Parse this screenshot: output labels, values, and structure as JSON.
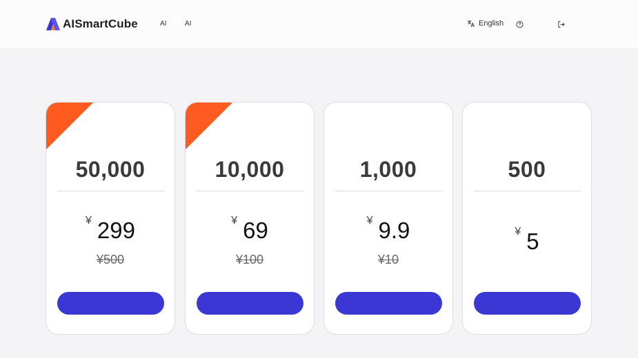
{
  "header": {
    "brand": "AISmartCube",
    "nav": [
      "AI",
      "AI"
    ],
    "language": "English"
  },
  "colors": {
    "accent": "#3b37d4",
    "ribbon": "#ff5a1f"
  },
  "cards": [
    {
      "credits": "50,000",
      "currency": "¥",
      "price": "299",
      "original": "¥500",
      "featured": true
    },
    {
      "credits": "10,000",
      "currency": "¥",
      "price": "69",
      "original": "¥100",
      "featured": true
    },
    {
      "credits": "1,000",
      "currency": "¥",
      "price": "9.9",
      "original": "¥10",
      "featured": false
    },
    {
      "credits": "500",
      "currency": "¥",
      "price": "5",
      "original": "",
      "featured": false
    }
  ]
}
